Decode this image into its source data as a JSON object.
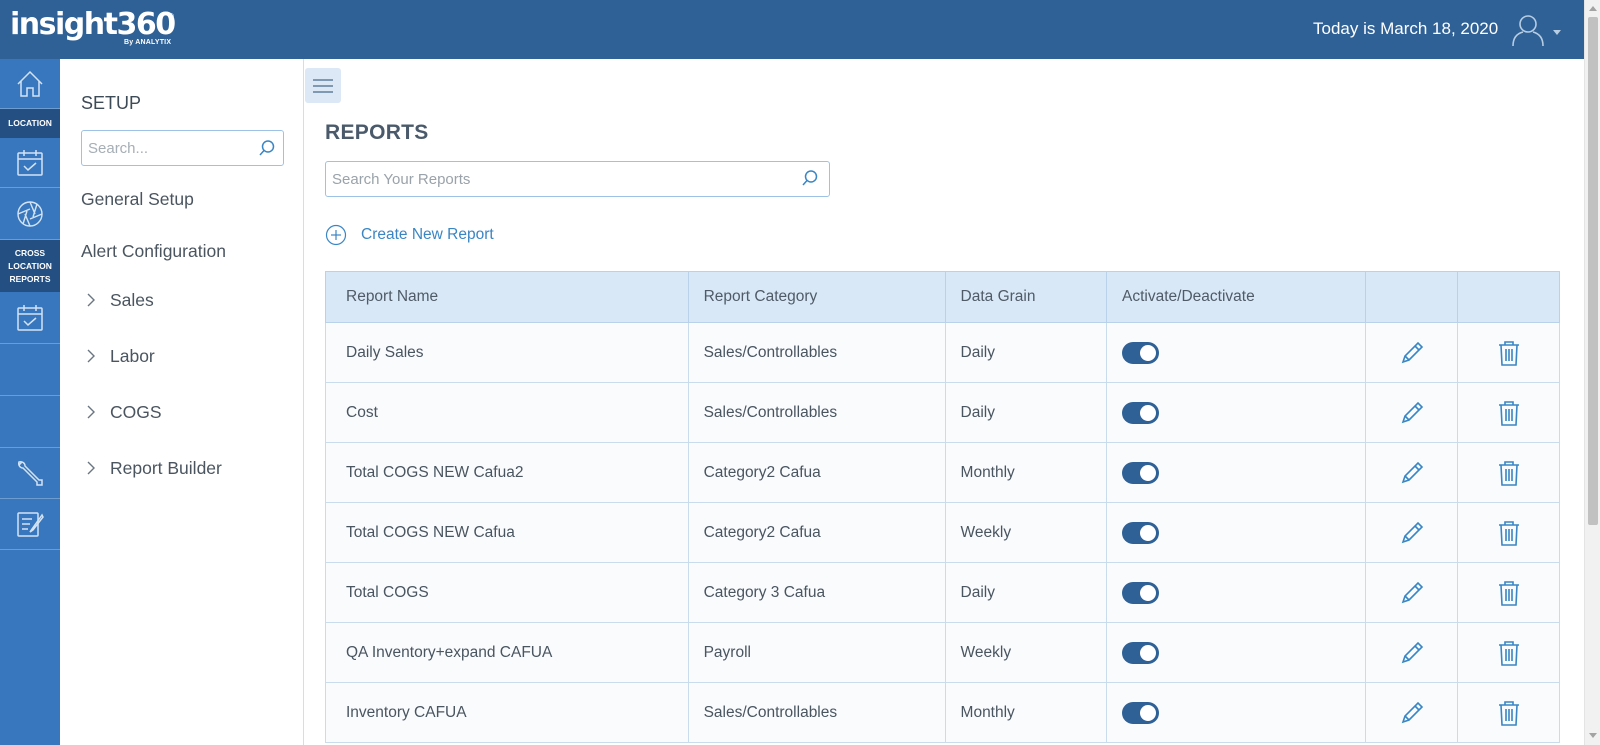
{
  "header": {
    "logo_text": "insight360",
    "logo_sub": "By ANALYTIX",
    "logo_mark": "®",
    "date_text": "Today is March 18, 2020",
    "user_icon": "user-icon",
    "user_caret_icon": "caret-down-icon"
  },
  "rail": {
    "location_label": "LOCATION",
    "cross_location_label": "CROSS LOCATION REPORTS",
    "icons": [
      "home-icon",
      "calendar-icon",
      "aperture-icon",
      "calendar-icon",
      "wrench-icon",
      "notepad-icon"
    ]
  },
  "sidebar": {
    "title": "SETUP",
    "search_placeholder": "Search...",
    "general_setup": "General Setup",
    "alert_configuration": "Alert Configuration",
    "expandable": [
      {
        "label": "Sales"
      },
      {
        "label": "Labor"
      },
      {
        "label": "COGS"
      },
      {
        "label": "Report Builder"
      }
    ]
  },
  "main": {
    "menu_icon": "hamburger-icon",
    "title": "REPORTS",
    "search_placeholder": "Search Your Reports",
    "create_label": "Create New Report",
    "table": {
      "headers": [
        "Report Name",
        "Report Category",
        "Data Grain",
        "Activate/Deactivate",
        "",
        ""
      ],
      "rows": [
        {
          "name": "Daily Sales",
          "category": "Sales/Controllables",
          "grain": "Daily",
          "active": true
        },
        {
          "name": "Cost",
          "category": "Sales/Controllables",
          "grain": "Daily",
          "active": true
        },
        {
          "name": "Total COGS NEW Cafua2",
          "category": "Category2 Cafua",
          "grain": "Monthly",
          "active": true
        },
        {
          "name": "Total COGS NEW Cafua",
          "category": "Category2 Cafua",
          "grain": "Weekly",
          "active": true
        },
        {
          "name": "Total COGS",
          "category": "Category 3 Cafua",
          "grain": "Daily",
          "active": true
        },
        {
          "name": "QA Inventory+expand CAFUA",
          "category": "Payroll",
          "grain": "Weekly",
          "active": true
        },
        {
          "name": "Inventory CAFUA",
          "category": "Sales/Controllables",
          "grain": "Monthly",
          "active": true
        }
      ]
    }
  },
  "colors": {
    "header_bg": "#2f6196",
    "rail_bg": "#3877bd",
    "rail_label_bg": "#234f82",
    "accent": "#3a86c4",
    "table_header_bg": "#d9e8f7",
    "toggle_on": "#2f6196"
  }
}
